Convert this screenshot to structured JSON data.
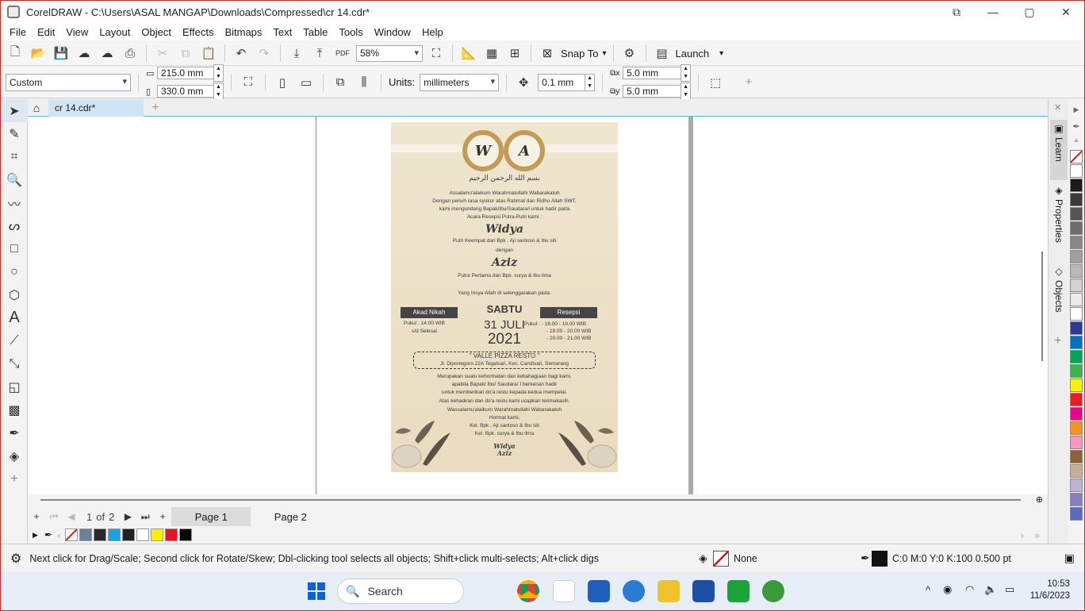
{
  "window": {
    "title": "CorelDRAW - C:\\Users\\ASAL MANGAP\\Downloads\\Compressed\\cr 14.cdr*",
    "controls": {
      "minimize": "—",
      "maximize": "▢",
      "close": "✕"
    }
  },
  "menu": [
    "File",
    "Edit",
    "View",
    "Layout",
    "Object",
    "Effects",
    "Bitmaps",
    "Text",
    "Table",
    "Tools",
    "Window",
    "Help"
  ],
  "toolbar": {
    "zoom": "58%",
    "pdf_label": "PDF",
    "snap_to": "Snap To",
    "launch": "Launch"
  },
  "property_bar": {
    "page_preset": "Custom",
    "width": "215.0 mm",
    "height": "330.0 mm",
    "units_label": "Units:",
    "units_value": "millimeters",
    "nudge": "0.1 mm",
    "dup_x": "5.0 mm",
    "dup_y": "5.0 mm"
  },
  "document_tab": "cr 14.cdr*",
  "invitation": {
    "initial_left": "W",
    "initial_right": "A",
    "arabic": "بسم الله الرحمن الرحيم",
    "lines_top": [
      "Assalamu'alaikum Warahmatullahi Wabarakatuh",
      "Dengan penuh rasa syukur atas Rahmat dan Ridho Allah SWT,",
      "kami mengundang Bapak/Ibu/Saudara/i untuk hadir pada",
      "Acara Resepsi Putra-Putri kami :"
    ],
    "bride": "Widya",
    "bride_desc": "Putri Keempat dari Bpk . Aji santoso & Ibu siti",
    "with": "dengan",
    "groom": "Aziz",
    "groom_desc": "Putra Pertama dari Bpk. surya & Ibu ilma",
    "intro": "Yang Insya Allah di selenggarakan pada:",
    "akad_label": "Akad Nikah",
    "akad_time": "Pukul : 14.00 WIB",
    "akad_end": "s/d Selesai",
    "day": "SABTU",
    "date": "31 JULI",
    "year": "2021",
    "resepsi_label": "Resepsi",
    "resepsi_times": [
      "Pukul : - 18.00 - 19.00 WIB",
      "- 19.00 - 20.00 WIB",
      "- 20.00 - 21.00 WIB"
    ],
    "venue": "\" VALLE PIZZA RESTO \"",
    "address": "Jl. Diponegoro 22A Tegalsari, Kec. Candisari, Semarang",
    "lines_bottom": [
      "Merupakan suatu kehormatan dan kebahagiaan bagi kami,",
      "apabila Bapak/ Ibu/ Saudara/ I berkenan hadir",
      "untuk memberikan do'a restu kepada kedua mempelai.",
      "Atas kehadiran dan do'a restu kami ucapkan terimakasih.",
      "Wassalamu'alaikum Warahmatullahi Wabarakatuh",
      "Hormat kami,",
      "Kel. Bpk . Aji santoso & Ibu siti",
      "Kel. Bpk. surya & Ibu ilma"
    ],
    "sign_1": "Widya",
    "sign_2": "Aziz"
  },
  "page_nav": {
    "current": "1",
    "of_label": "of",
    "total": "2",
    "pages": [
      "Page 1",
      "Page 2"
    ]
  },
  "docker_tabs": [
    "Learn",
    "Properties",
    "Objects"
  ],
  "status": {
    "hint": "Next click for Drag/Scale; Second click for Rotate/Skew; Dbl-clicking tool selects all objects; Shift+click multi-selects; Alt+click digs",
    "fill": "None",
    "outline": "C:0 M:0 Y:0 K:100  0.500 pt"
  },
  "taskbar": {
    "search": "Search",
    "time": "10:53",
    "date": "11/6/2023"
  },
  "colors": {
    "doc_palette": [
      "#6b7f9b",
      "#26282b",
      "#1ba1e2",
      "#222222",
      "#ffffff",
      "#ffee00",
      "#e81123",
      "#000000"
    ],
    "palette": [
      "#ffffff",
      "#1a1a1a",
      "#3a3a3a",
      "#555555",
      "#6e6e6e",
      "#878787",
      "#a0a0a0",
      "#b9b9b9",
      "#d2d2d2",
      "#ebebeb",
      "#ffffff",
      "#2b3990",
      "#0072bc",
      "#00a651",
      "#39b54a",
      "#fff200",
      "#ed1c24",
      "#ec008c",
      "#f7941d",
      "#f49ac1",
      "#8c6239",
      "#c7b299",
      "#bfb3d6",
      "#8781bd",
      "#5c6bc0"
    ]
  }
}
